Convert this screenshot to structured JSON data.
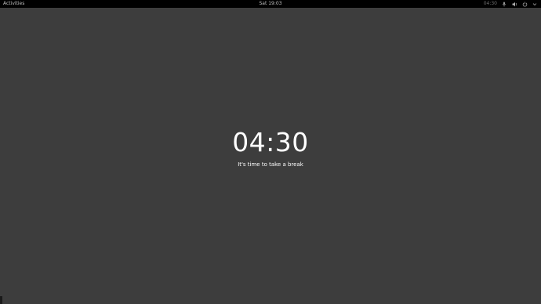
{
  "topbar": {
    "activities_label": "Activities",
    "clock_label": "Sat 19:03",
    "status": {
      "timer_label": "04:30",
      "icons": [
        "microphone-icon",
        "volume-icon",
        "power-icon",
        "chevron-down-icon"
      ]
    }
  },
  "break_screen": {
    "countdown": "04:30",
    "message": "It's time to take a break"
  },
  "colors": {
    "background": "#3d3d3d",
    "topbar": "#000000",
    "text": "#ffffff"
  }
}
